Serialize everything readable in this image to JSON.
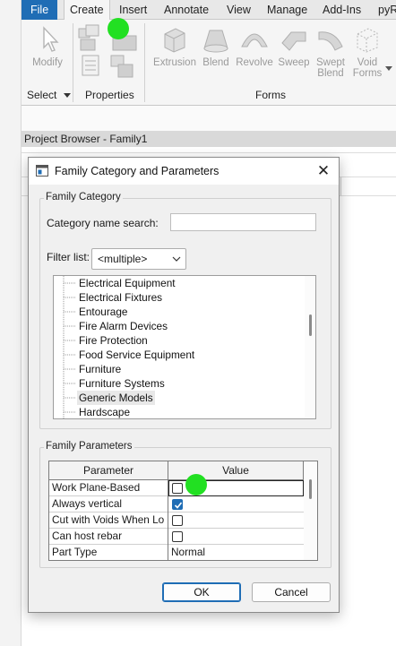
{
  "ribbon": {
    "tabs": [
      "File",
      "Create",
      "Insert",
      "Annotate",
      "View",
      "Manage",
      "Add-Ins",
      "pyR"
    ],
    "active_tab": "Create",
    "tools": {
      "modify": "Modify",
      "extrusion": "Extrusion",
      "blend": "Blend",
      "revolve": "Revolve",
      "sweep": "Sweep",
      "swept_blend_1": "Swept",
      "swept_blend_2": "Blend",
      "void_forms_1": "Void",
      "void_forms_2": "Forms"
    },
    "panels": {
      "select": "Select",
      "properties": "Properties",
      "forms": "Forms"
    }
  },
  "project_browser": {
    "title": "Project Browser - Family1"
  },
  "dialog": {
    "title": "Family Category and Parameters",
    "close_glyph": "✕",
    "family_category": {
      "group_label": "Family Category",
      "search_label": "Category name search:",
      "search_value": "",
      "filter_label": "Filter list:",
      "filter_value": "<multiple>",
      "items": [
        "Electrical Equipment",
        "Electrical Fixtures",
        "Entourage",
        "Fire Alarm Devices",
        "Fire Protection",
        "Food Service Equipment",
        "Furniture",
        "Furniture Systems",
        "Generic Models",
        "Hardscape"
      ],
      "selected_item": "Generic Models"
    },
    "family_parameters": {
      "group_label": "Family Parameters",
      "columns": [
        "Parameter",
        "Value"
      ],
      "rows": [
        {
          "name": "Work Plane-Based",
          "type": "checkbox",
          "checked": false
        },
        {
          "name": "Always vertical",
          "type": "checkbox",
          "checked": true
        },
        {
          "name": "Cut with Voids When Lo",
          "type": "checkbox",
          "checked": false
        },
        {
          "name": "Can host rebar",
          "type": "checkbox",
          "checked": false
        },
        {
          "name": "Part Type",
          "type": "text",
          "value": "Normal"
        }
      ]
    },
    "buttons": {
      "ok": "OK",
      "cancel": "Cancel"
    }
  },
  "colors": {
    "accent": "#1f6db5",
    "cursor_marker": "#22e022"
  }
}
